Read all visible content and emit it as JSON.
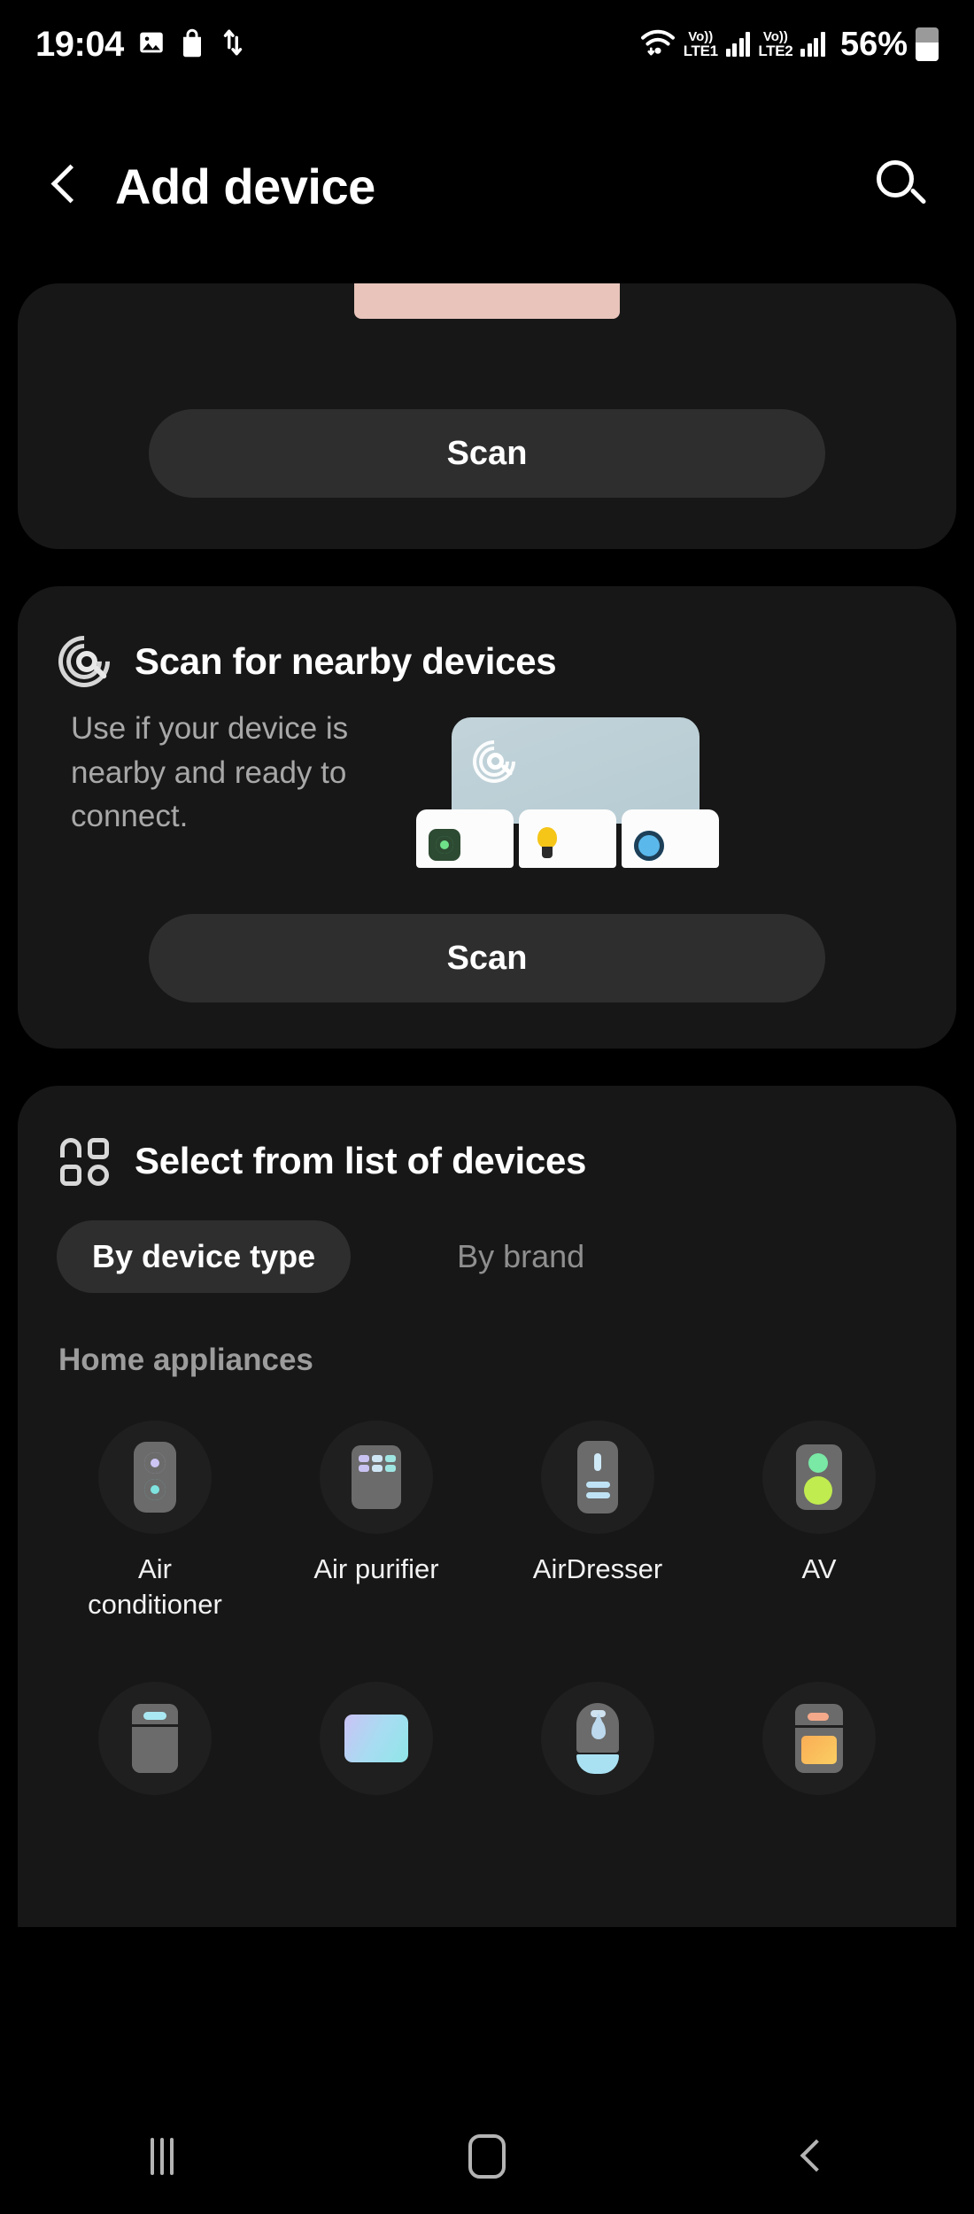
{
  "status_bar": {
    "time": "19:04",
    "icons_left": [
      "image-icon",
      "shopping-bag-icon",
      "data-transfer-icon"
    ],
    "wifi": "wifi-icon",
    "sim1": {
      "volte": "Vo))",
      "network": "LTE1"
    },
    "sim2": {
      "volte": "Vo))",
      "network": "LTE2"
    },
    "battery_percent": "56%"
  },
  "app_bar": {
    "back": "back-arrow",
    "title": "Add device",
    "search": "search-icon"
  },
  "qr_card": {
    "scan_label": "Scan"
  },
  "nearby_card": {
    "icon": "radar-scan-icon",
    "title": "Scan for nearby devices",
    "description": "Use if your device is nearby and ready to connect.",
    "scan_label": "Scan",
    "illustration": {
      "hub": "smart-hub",
      "devices": [
        "hub-icon",
        "lightbulb-icon",
        "sensor-icon"
      ]
    }
  },
  "list_card": {
    "icon": "device-grid-icon",
    "title": "Select from list of devices",
    "tabs": [
      {
        "label": "By device type",
        "active": true
      },
      {
        "label": "By brand",
        "active": false
      }
    ],
    "category": "Home appliances",
    "devices": [
      {
        "label": "Air conditioner",
        "icon": "air-conditioner-icon"
      },
      {
        "label": "Air purifier",
        "icon": "air-purifier-icon"
      },
      {
        "label": "AirDresser",
        "icon": "airdresser-icon"
      },
      {
        "label": "AV",
        "icon": "av-speaker-icon"
      },
      {
        "label": "",
        "icon": "dishwasher-icon"
      },
      {
        "label": "",
        "icon": "tv-icon"
      },
      {
        "label": "",
        "icon": "dehumidifier-icon"
      },
      {
        "label": "",
        "icon": "oven-icon"
      }
    ]
  },
  "nav_bar": {
    "recents": "recents-icon",
    "home": "home-icon",
    "back": "back-icon"
  },
  "colors": {
    "background": "#000000",
    "card": "#171717",
    "button": "#2e2e2e",
    "text_primary": "#ffffff",
    "text_secondary": "#a8a8a8",
    "accent_green": "#c0ec4f",
    "accent_orange": "#f9ad56",
    "accent_cyan": "#8fe6e8"
  }
}
